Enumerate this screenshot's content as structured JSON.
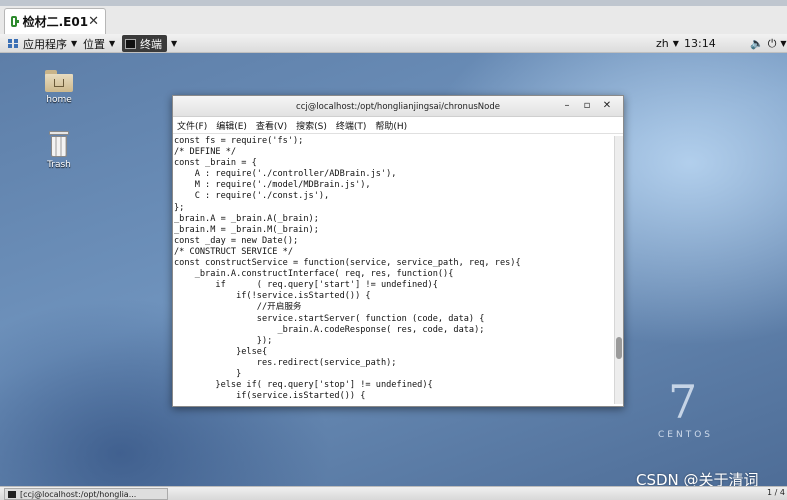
{
  "vm_tab": {
    "title": "检材二.E01",
    "close": "✕"
  },
  "panel": {
    "applications": "应用程序",
    "places": "位置",
    "terminal": "终端",
    "lang": "zh",
    "time": "13:14",
    "volume_icon": "speaker-icon",
    "power_icon": "power-icon"
  },
  "desktop": {
    "icons": [
      {
        "label": "home",
        "icon": "home-folder-icon"
      },
      {
        "label": "Trash",
        "icon": "trash-icon"
      }
    ],
    "brand_numeral": "7",
    "brand_name": "CENTOS",
    "watermark": "CSDN @关于清词"
  },
  "terminal": {
    "title": "ccj@localhost:/opt/honglianjingsai/chronusNode",
    "buttons": {
      "minimize": "–",
      "maximize": "▫",
      "close": "✕"
    },
    "menu": [
      "文件(F)",
      "编辑(E)",
      "查看(V)",
      "搜索(S)",
      "终端(T)",
      "帮助(H)"
    ],
    "lines": [
      "const fs = require('fs');",
      "/* DEFINE */",
      "const _brain = {",
      "    A : require('./controller/ADBrain.js'),",
      "    M : require('./model/MDBrain.js'),",
      "    C : require('./const.js'),",
      "};",
      "_brain.A = _brain.A(_brain);",
      "_brain.M = _brain.M(_brain);",
      "const _day = new Date();",
      "/* CONSTRUCT SERVICE */",
      "const constructService = function(service, service_path, req, res){",
      "    _brain.A.constructInterface( req, res, function(){",
      "        if      ( req.query['start'] != undefined){",
      "            if(!service.isStarted()) {",
      "                //开启服务",
      "                service.startServer( function (code, data) {",
      "                    _brain.A.codeResponse( res, code, data);",
      "                });",
      "            }else{",
      "                res.redirect(service_path);",
      "            }",
      "        }else if( req.query['stop'] != undefined){",
      "            if(service.isStarted()) {"
    ]
  },
  "taskbar": {
    "item": "[ccj@localhost:/opt/honglia...",
    "pager": "1 / 4"
  }
}
